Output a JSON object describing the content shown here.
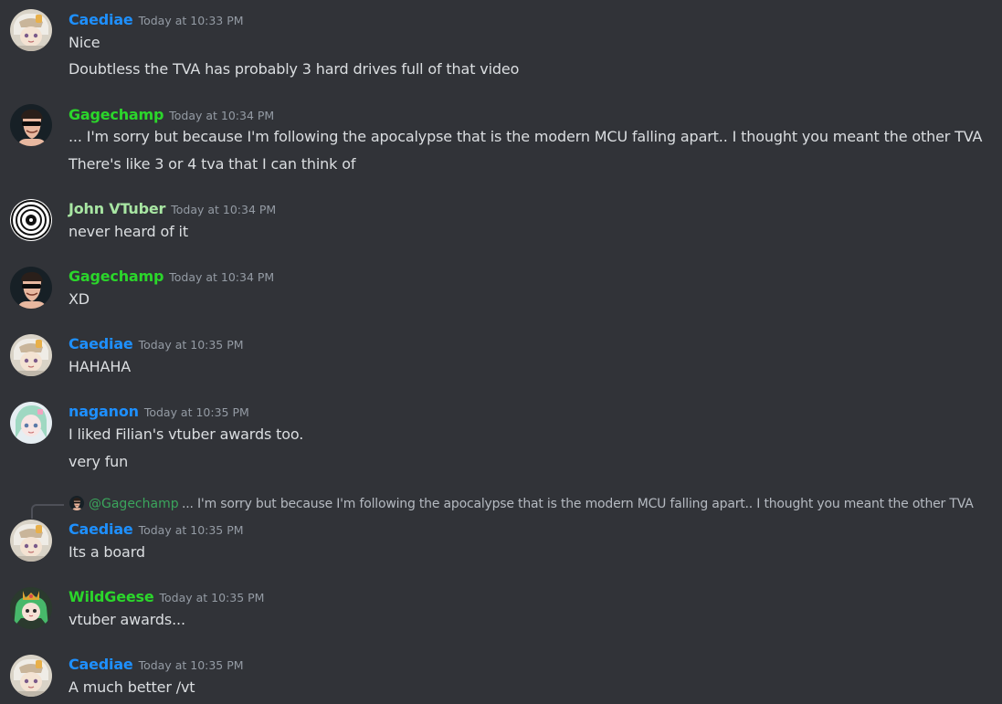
{
  "colors": {
    "background": "#313338",
    "text": "#dbdee1",
    "timestamp": "#949ba4",
    "blue_name": "#1e90ff",
    "green_name": "#2bd62b",
    "light_green_name": "#a8e6a3"
  },
  "messages": [
    {
      "username": "Caediae",
      "timestamp": "Today at 10:33 PM",
      "name_color": "#1e90ff",
      "avatar": "caediae-avatar",
      "lines": [
        "Nice",
        "Doubtless the TVA has probably 3 hard drives full of that video"
      ]
    },
    {
      "username": "Gagechamp",
      "timestamp": "Today at 10:34 PM",
      "name_color": "#2bd62b",
      "avatar": "gagechamp-avatar",
      "lines": [
        "... I'm sorry but because I'm following the apocalypse that is the modern MCU falling apart.. I thought you meant the other TVA",
        "There's like 3 or 4 tva that I can think of"
      ]
    },
    {
      "username": "John VTuber",
      "timestamp": "Today at 10:34 PM",
      "name_color": "#a8e6a3",
      "avatar": "john-vtuber-avatar",
      "lines": [
        "never heard of it"
      ]
    },
    {
      "username": "Gagechamp",
      "timestamp": "Today at 10:34 PM",
      "name_color": "#2bd62b",
      "avatar": "gagechamp-avatar",
      "lines": [
        "XD"
      ]
    },
    {
      "username": "Caediae",
      "timestamp": "Today at 10:35 PM",
      "name_color": "#1e90ff",
      "avatar": "caediae-avatar",
      "lines": [
        "HAHAHA"
      ]
    },
    {
      "username": "naganon",
      "timestamp": "Today at 10:35 PM",
      "name_color": "#1e90ff",
      "avatar": "naganon-avatar",
      "lines": [
        "I liked Filian's vtuber awards too.",
        "very fun"
      ]
    },
    {
      "username": "Caediae",
      "timestamp": "Today at 10:35 PM",
      "name_color": "#1e90ff",
      "avatar": "caediae-avatar",
      "lines": [
        "Its a board"
      ],
      "reply": {
        "mention": "@Gagechamp",
        "mention_color": "#3ba55c",
        "text": "... I'm sorry but because I'm following the apocalypse that is the modern MCU falling apart.. I thought you meant the other TVA"
      }
    },
    {
      "username": "WildGeese",
      "timestamp": "Today at 10:35 PM",
      "name_color": "#2bd62b",
      "avatar": "wildgeese-avatar",
      "lines": [
        "vtuber awards..."
      ]
    },
    {
      "username": "Caediae",
      "timestamp": "Today at 10:35 PM",
      "name_color": "#1e90ff",
      "avatar": "caediae-avatar",
      "lines": [
        "A much better /vt"
      ]
    }
  ]
}
